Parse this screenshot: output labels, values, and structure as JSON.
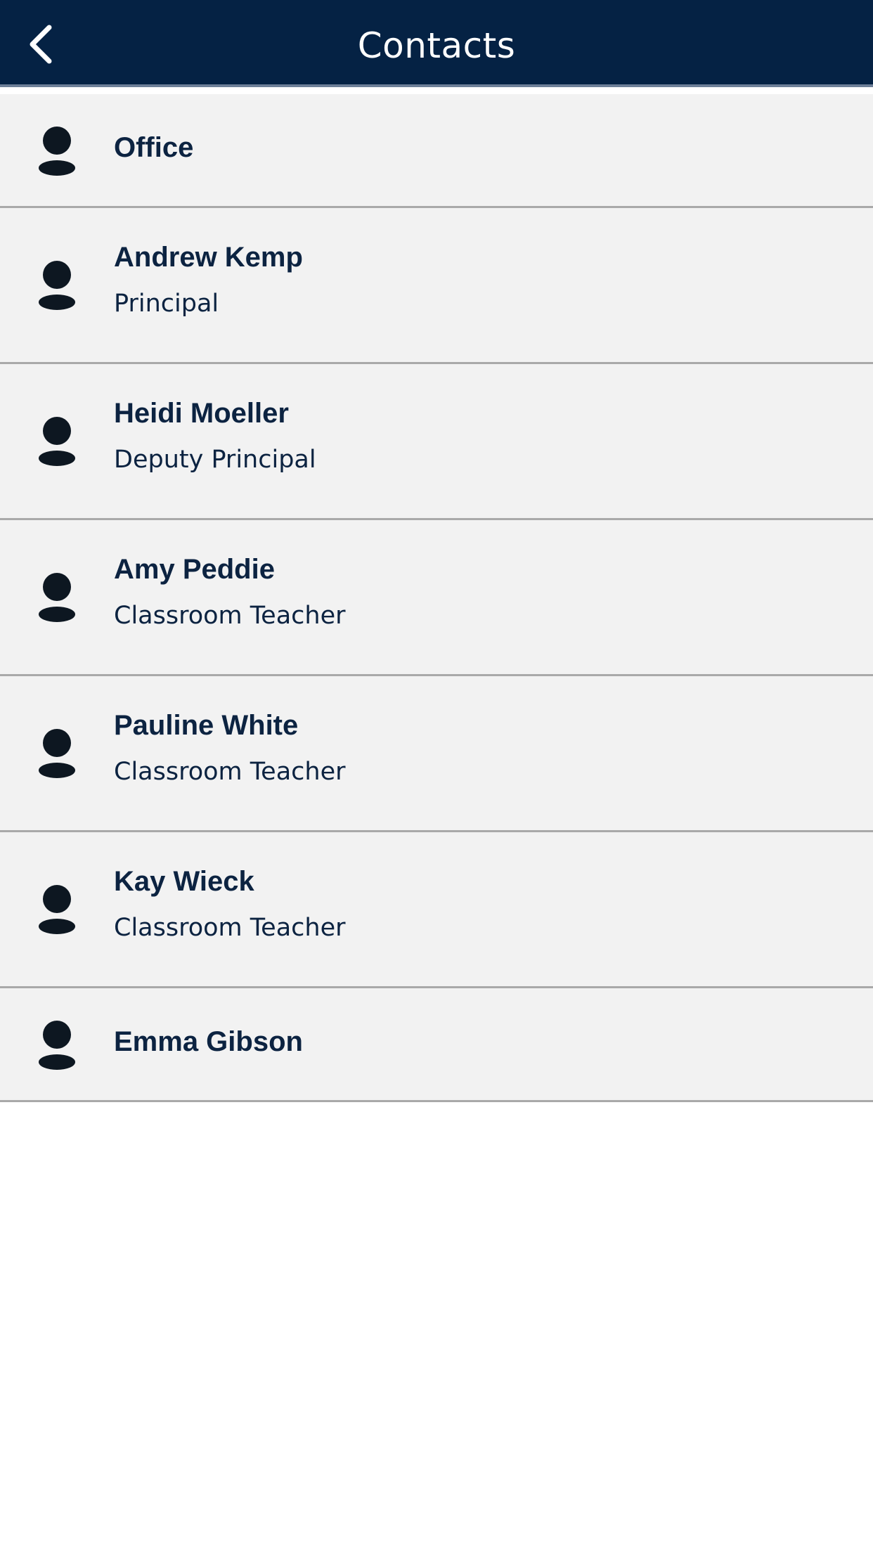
{
  "header": {
    "title": "Contacts",
    "back_icon": "chevron-left-icon",
    "background": "#052244"
  },
  "contacts": [
    {
      "name": "Office",
      "role": ""
    },
    {
      "name": "Andrew Kemp",
      "role": "Principal"
    },
    {
      "name": "Heidi Moeller",
      "role": "Deputy Principal"
    },
    {
      "name": "Amy Peddie",
      "role": "Classroom Teacher"
    },
    {
      "name": "Pauline White",
      "role": "Classroom Teacher"
    },
    {
      "name": "Kay Wieck",
      "role": "Classroom Teacher"
    },
    {
      "name": "Emma Gibson",
      "role": ""
    }
  ],
  "colors": {
    "row_background": "#f2f2f2",
    "text": "#0c2341",
    "icon": "#0d1721",
    "divider": "#a9a9a9"
  }
}
